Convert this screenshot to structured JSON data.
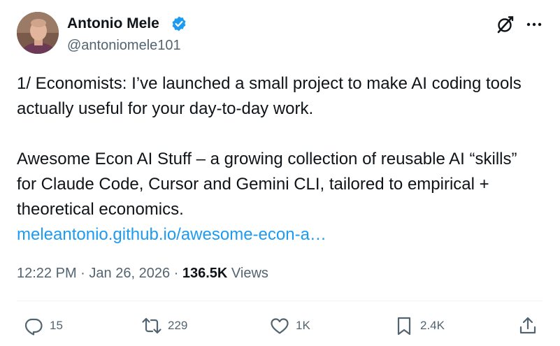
{
  "author": {
    "name": "Antonio Mele",
    "handle": "@antoniomele101",
    "verified": true,
    "avatar_icon": "avatar-photo"
  },
  "header_icons": [
    "grok-icon",
    "more-icon"
  ],
  "tweet": {
    "paragraph1": "1/ Economists: I’ve launched a small project to make AI coding tools actually useful for your day-to-day work.",
    "paragraph2": "Awesome Econ AI Stuff – a growing collection of reusable AI “skills” for Claude Code, Cursor and Gemini CLI, tailored to empirical + theoretical economics.",
    "link_text": "meleantonio.github.io/awesome-econ-a…"
  },
  "meta": {
    "time": "12:22 PM",
    "separator": "·",
    "date": "Jan 26, 2026",
    "views_count": "136.5K",
    "views_label": "Views"
  },
  "actions": {
    "replies": "15",
    "reposts": "229",
    "likes": "1K",
    "bookmarks": "2.4K"
  },
  "colors": {
    "text": "#0f1419",
    "secondary": "#536471",
    "link": "#1d9bf0",
    "verified": "#1d9bf0",
    "divider": "#eff3f4"
  }
}
